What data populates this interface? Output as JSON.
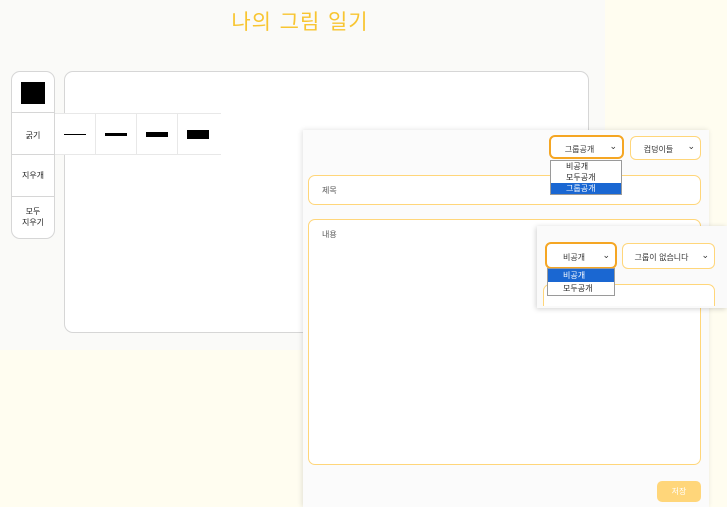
{
  "page": {
    "title": "나의 그림 일기"
  },
  "toolbar": {
    "color_swatch": "#000000",
    "thickness_label": "굵기",
    "eraser_label": "지우개",
    "clear_all_line1": "모두",
    "clear_all_line2": "지우기",
    "thickness_options": [
      "thin",
      "medium",
      "thick",
      "extra-thick"
    ]
  },
  "modal_main": {
    "visibility_select": {
      "value": "그룹공개",
      "options": [
        "비공개",
        "모두공개",
        "그룹공개"
      ],
      "selected": "그룹공개"
    },
    "group_select": {
      "value": "컴덩이들"
    },
    "title_placeholder": "제목",
    "content_placeholder": "내용",
    "save_label": "저장"
  },
  "modal_secondary": {
    "visibility_select": {
      "value": "비공개",
      "options": [
        "비공개",
        "모두공개"
      ],
      "selected": "비공개"
    },
    "group_select": {
      "value": "그룹이 없습니다"
    }
  },
  "colors": {
    "accent": "#f8c531",
    "border": "#ffd67a",
    "selection": "#1a67d2"
  }
}
